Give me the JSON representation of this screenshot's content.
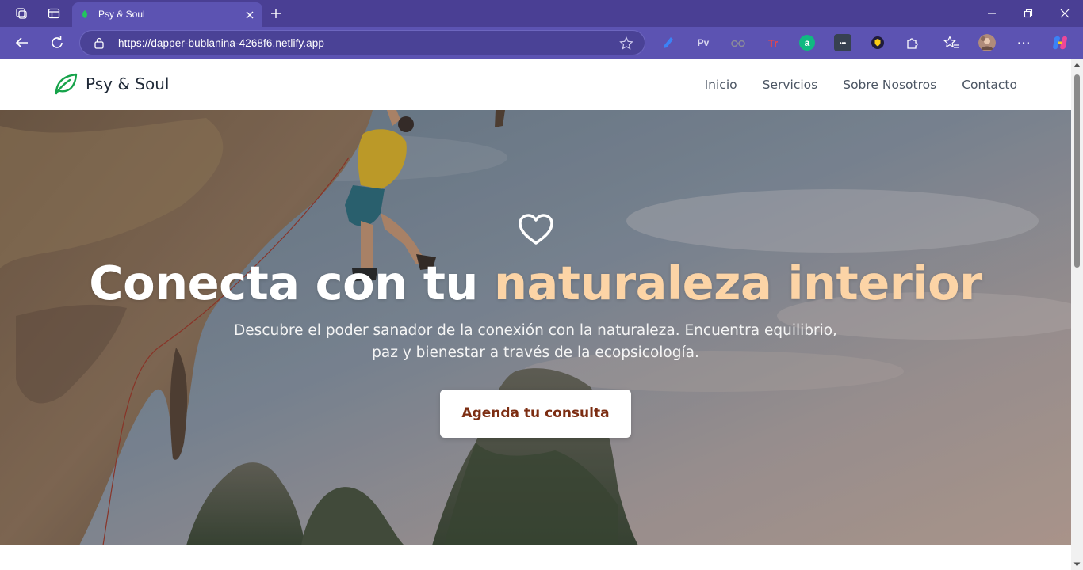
{
  "browser": {
    "tab": {
      "title": "Psy & Soul"
    },
    "url": "https://dapper-bublanina-4268f6.netlify.app",
    "extensions": [
      {
        "name": "pencil-extension-icon",
        "label": ""
      },
      {
        "name": "pv-extension",
        "label": "Pv"
      },
      {
        "name": "glasses-extension-icon",
        "label": ""
      },
      {
        "name": "tr-extension",
        "label": "Tr"
      },
      {
        "name": "a-extension",
        "label": "a"
      },
      {
        "name": "dots-extension",
        "label": "•••"
      },
      {
        "name": "shield-extension-icon",
        "label": ""
      }
    ],
    "colors": {
      "tabbar": "#4a3f94",
      "toolbar": "#5c53b2"
    }
  },
  "site": {
    "brand": "Psy & Soul",
    "nav": [
      "Inicio",
      "Servicios",
      "Sobre Nosotros",
      "Contacto"
    ],
    "hero": {
      "title_main": "Conecta con tu ",
      "title_accent": "naturaleza interior",
      "subtitle": "Descubre el poder sanador de la conexión con la naturaleza. Encuentra equilibrio, paz y bienestar a través de la ecopsicología.",
      "cta": "Agenda tu consulta"
    },
    "colors": {
      "brand_green": "#16a34a",
      "accent_peach": "#fcd4a6",
      "cta_text": "#7c2d12"
    }
  }
}
